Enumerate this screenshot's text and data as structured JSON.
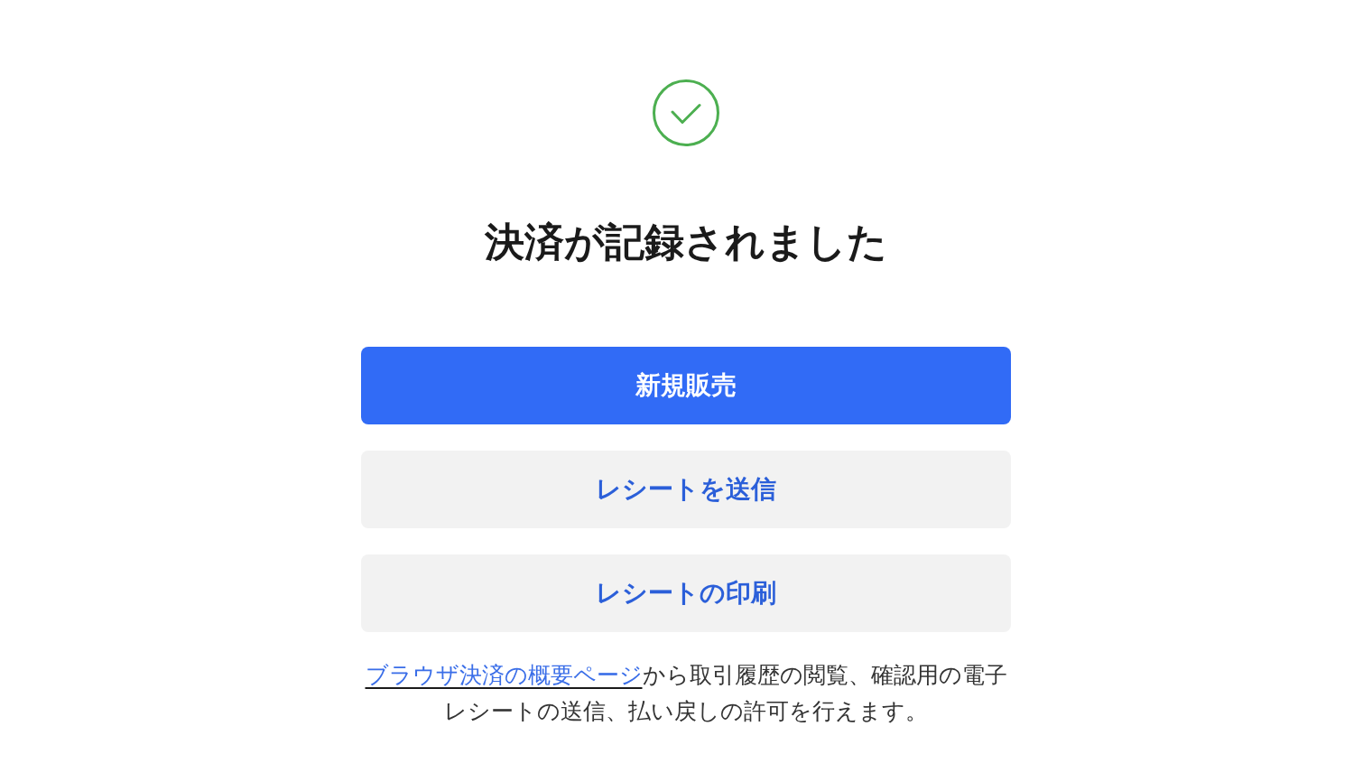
{
  "title": "決済が記録されました",
  "buttons": [
    {
      "label": "新規販売",
      "kind": "primary"
    },
    {
      "label": "レシートを送信",
      "kind": "secondary"
    },
    {
      "label": "レシートの印刷",
      "kind": "secondary"
    }
  ],
  "note": {
    "link": "ブラウザ決済の概要ページ",
    "text": "から取引履歴の閲覧、確認用の電子レシートの送信、払い戻しの許可を行えます。"
  }
}
